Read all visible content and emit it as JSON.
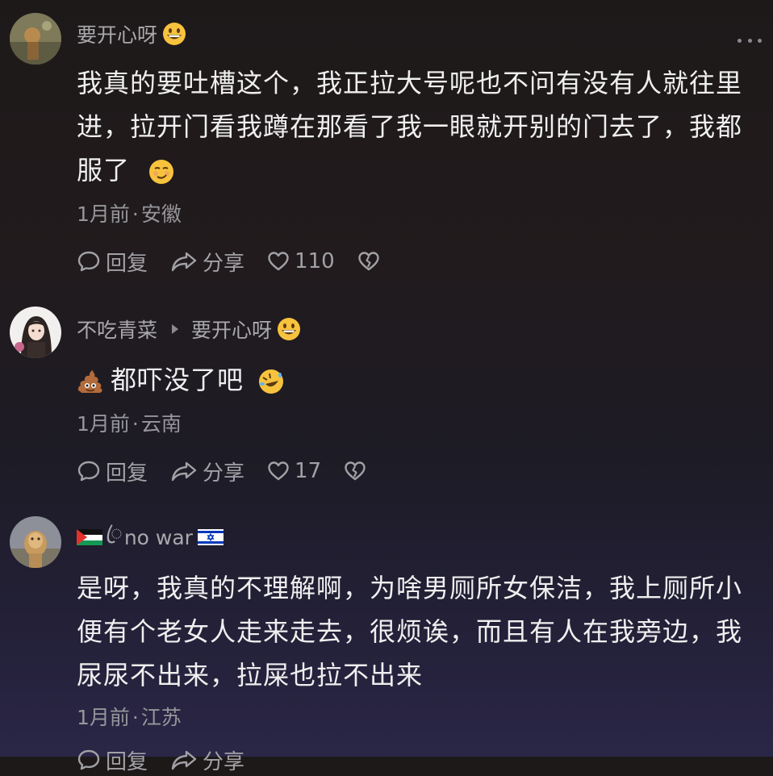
{
  "comments": [
    {
      "username": "要开心呀",
      "username_emoji": "grinning-face-emoji",
      "text_lines": [
        "我真的要吐槽这个，我正拉大号呢也不问有没有人就往里",
        "进，拉开门看我蹲在那看了我一眼就开别的门去了，我都",
        "服了"
      ],
      "text_emoji": "smirking-face-emoji",
      "time": "1月前",
      "location": "安徽",
      "reply_label": "回复",
      "share_label": "分享",
      "likes": "110"
    },
    {
      "username": "不吃青菜",
      "reply_to": "要开心呀",
      "reply_to_emoji": "grinning-face-emoji",
      "text_prefix_emoji": "pile-of-poo-emoji",
      "text": "都吓没了吧",
      "text_emoji": "rolling-on-floor-laughing-emoji",
      "time": "1月前",
      "location": "云南",
      "reply_label": "回复",
      "share_label": "分享",
      "likes": "17"
    },
    {
      "username_flags": [
        "palestine-flag",
        "israel-flag"
      ],
      "username_symbol": "ꦿ",
      "username": "no war",
      "text_lines": [
        "是呀，我真的不理解啊，为啥男厕所女保洁，我上厕所小",
        "便有个老女人走来走去，很烦诶，而且有人在我旁边，我",
        "尿尿不出来，拉屎也拉不出来"
      ],
      "time": "1月前",
      "location": "江苏",
      "reply_label": "回复",
      "share_label": "分享"
    }
  ],
  "separator": "·",
  "icons": {
    "more": "more-dots-icon",
    "reply": "comment-bubble-icon",
    "share": "share-arrow-icon",
    "like": "heart-icon",
    "dislike": "broken-heart-icon"
  }
}
